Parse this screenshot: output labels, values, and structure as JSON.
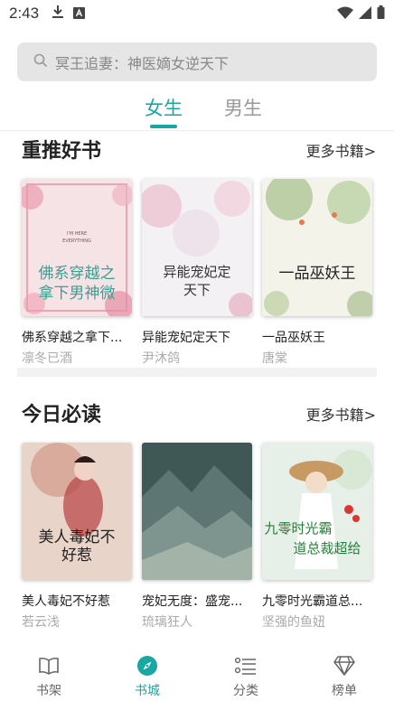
{
  "status_bar": {
    "time": "2:43"
  },
  "search": {
    "placeholder": "冥王追妻：神医嫡女逆天下"
  },
  "tabs": [
    {
      "label": "女生",
      "active": true
    },
    {
      "label": "男生",
      "active": false
    }
  ],
  "sections": [
    {
      "title": "重推好书",
      "more": "更多书籍>",
      "books": [
        {
          "title": "佛系穿越之拿下...",
          "author": "凛冬已酒",
          "cover_text": "佛系穿越之拿下男神微"
        },
        {
          "title": "异能宠妃定天下",
          "author": "尹沐鸽",
          "cover_text": "异能宠妃定天下"
        },
        {
          "title": "一品巫妖王",
          "author": "唐棠",
          "cover_text": "一品巫妖王"
        }
      ]
    },
    {
      "title": "今日必读",
      "more": "更多书籍>",
      "books": [
        {
          "title": "美人毒妃不好惹",
          "author": "若云浅",
          "cover_text": "美人毒妃不好惹"
        },
        {
          "title": "宠妃无度：盛宠...",
          "author": "琉璃狂人",
          "cover_text": ""
        },
        {
          "title": "九零时光霸道总...",
          "author": "坚强的鱼妞",
          "cover_text": "九零时光霸道总裁超给"
        }
      ]
    }
  ],
  "bottom_nav": [
    {
      "label": "书架",
      "icon": "book-open-icon",
      "active": false
    },
    {
      "label": "书城",
      "icon": "compass-icon",
      "active": true
    },
    {
      "label": "分类",
      "icon": "list-icon",
      "active": false
    },
    {
      "label": "榜单",
      "icon": "diamond-icon",
      "active": false
    }
  ],
  "colors": {
    "accent": "#1aa7a1"
  }
}
